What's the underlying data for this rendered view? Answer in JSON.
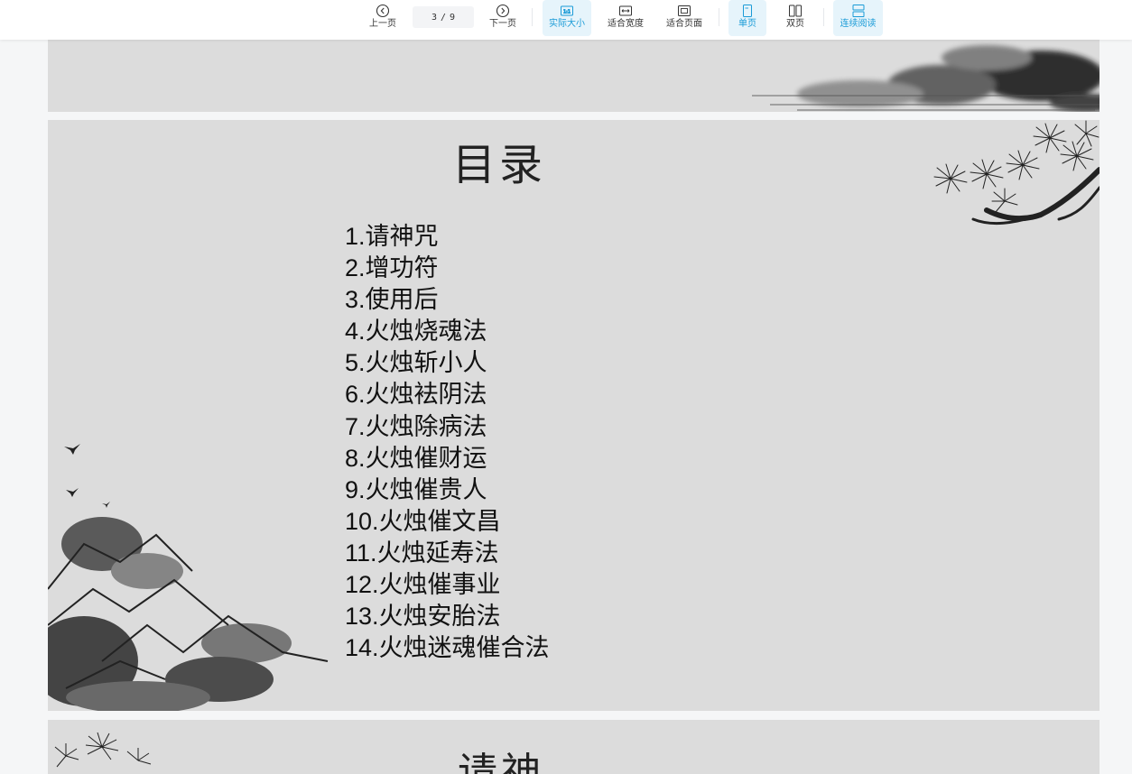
{
  "toolbar": {
    "prev_label": "上一页",
    "current_page": "3",
    "page_separator": "/",
    "total_pages": "9",
    "next_label": "下一页",
    "actual_size_label": "实际大小",
    "fit_width_label": "适合宽度",
    "fit_page_label": "适合页面",
    "single_page_label": "单页",
    "double_page_label": "双页",
    "continuous_label": "连续阅读",
    "accent_color": "#1a9bd7"
  },
  "slide": {
    "title": "目录",
    "items": [
      "1.请神咒",
      "2.增功符",
      "3.使用后",
      "4.火烛烧魂法",
      "5.火烛斩小人",
      "6.火烛袪阴法",
      "7.火烛除病法",
      "8.火烛催财运",
      "9.火烛催贵人",
      "10.火烛催文昌",
      "11.火烛延寿法",
      "12.火烛催事业",
      "13.火烛安胎法",
      "14.火烛迷魂催合法"
    ]
  },
  "next_slide": {
    "title_partial": "请神"
  }
}
